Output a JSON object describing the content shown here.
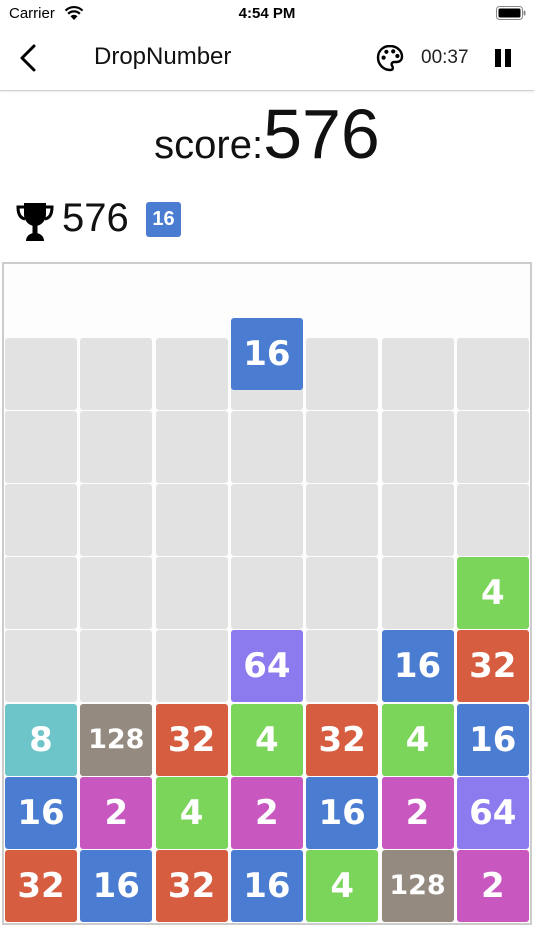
{
  "status_bar": {
    "carrier": "Carrier",
    "time": "4:54 PM"
  },
  "nav": {
    "title": "DropNumber",
    "timer": "00:37"
  },
  "score": {
    "label": "score:",
    "value": "576"
  },
  "best": {
    "score": "576",
    "tile": "16"
  },
  "colors": {
    "2": "#c857c0",
    "4": "#7bd55a",
    "8": "#6dc5c9",
    "16": "#4a7dd1",
    "32": "#d65d3f",
    "64": "#8b7bee",
    "128": "#948a80"
  },
  "board": {
    "columns": 7,
    "visible_rows": 8,
    "dropping_tile": {
      "column": 3,
      "value": 16
    },
    "grid": [
      [
        null,
        null,
        null,
        null,
        null,
        null,
        null
      ],
      [
        null,
        null,
        null,
        null,
        null,
        null,
        null
      ],
      [
        null,
        null,
        null,
        null,
        null,
        null,
        null
      ],
      [
        null,
        null,
        null,
        null,
        null,
        null,
        4
      ],
      [
        null,
        null,
        null,
        64,
        null,
        16,
        32
      ],
      [
        8,
        128,
        32,
        4,
        32,
        4,
        16
      ],
      [
        16,
        2,
        4,
        2,
        16,
        2,
        64
      ],
      [
        32,
        16,
        32,
        16,
        4,
        128,
        2
      ]
    ]
  }
}
